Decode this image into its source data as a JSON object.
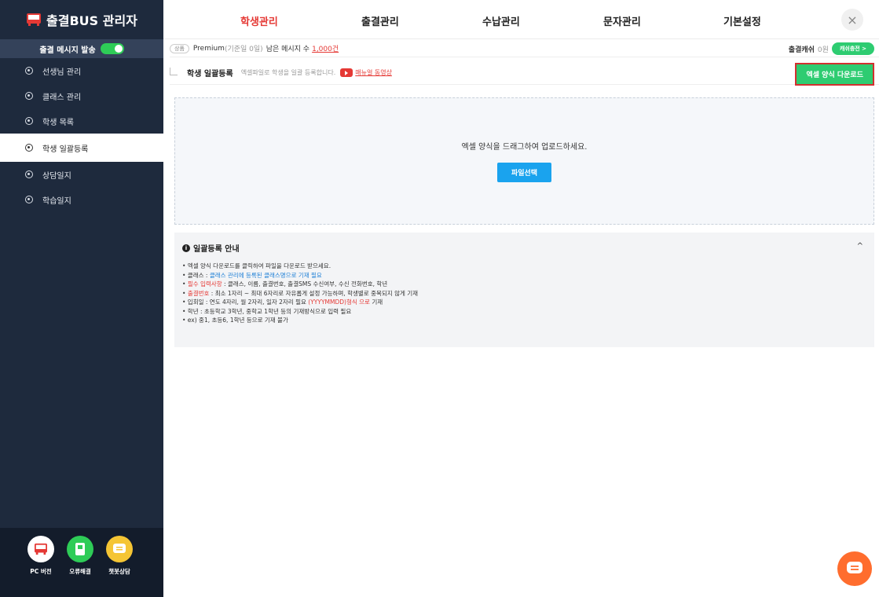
{
  "sidebar": {
    "brand": "출결BUS 관리자",
    "notify_label": "출결 메시지 발송",
    "items": [
      {
        "label": "선생님 관리"
      },
      {
        "label": "클래스 관리"
      },
      {
        "label": "학생 목록"
      },
      {
        "label": "학생 일괄등록"
      },
      {
        "label": "상담일지"
      },
      {
        "label": "학습일지"
      }
    ],
    "bottom": [
      {
        "label": "PC 버전",
        "color": "#e53935"
      },
      {
        "label": "오류해결",
        "color": "#2ecc57"
      },
      {
        "label": "챗봇상담",
        "color": "#f5c534"
      }
    ]
  },
  "topnav": {
    "tabs": [
      {
        "label": "학생관리"
      },
      {
        "label": "출결관리"
      },
      {
        "label": "수납관리"
      },
      {
        "label": "문자관리"
      },
      {
        "label": "기본설정"
      }
    ],
    "close": "×"
  },
  "infobar": {
    "tag": "상품",
    "plan": "Premium",
    "plan_note": "(기준일 0일)",
    "remain_label": "남은 메시지 수",
    "remain_value": "1,000건",
    "cash_label": "출결캐쉬",
    "cash_value": "0원",
    "cash_btn": "캐쉬충전 >"
  },
  "pagehead": {
    "title": "학생 일괄등록",
    "desc": "엑셀파일로 학생을 일괄 등록합니다.",
    "video_link": "매뉴얼 동영상",
    "download_btn": "엑셀 양식 다운로드"
  },
  "dropzone": {
    "text": "엑셀 양식을 드래그하여 업로드하세요.",
    "button": "파일선택"
  },
  "guide": {
    "title": "일괄등록 안내",
    "lines": [
      {
        "a": "• 엑셀 양식 다운로드를 클릭하여 파일을 다운로드 받으세요.",
        "b": "",
        "c": ""
      },
      {
        "a": "• 클래스 : ",
        "b": "클래스 관리에 등록된 클래스명으로 기재 필요",
        "c": ""
      },
      {
        "a": "• ",
        "b": "필수 입력사항",
        "c": " : 클래스, 이름, 출결번호, 출결SMS 수신여부, 수신 전화번호, 학년"
      },
      {
        "a": "• ",
        "b": "출결번호",
        "c": " : 최소 1자리 ~ 최대 6자리로 자유롭게 설정 가능하며, 학생별로 중복되지 않게 기재"
      },
      {
        "a": "• 입회일 : 연도 4자리, 월 2자리, 일자 2자리 필요 ",
        "b": "(YYYYMMDD)형식 으로",
        "c": " 기재"
      },
      {
        "a": "• 학년 : 초등학교 3학년, 중학교 1학년 등의 기재방식으로 입력 필요",
        "b": "",
        "c": ""
      },
      {
        "a": "• ex) 중1, 초등6, 1학년 등으로 기재 불가",
        "b": "",
        "c": ""
      }
    ]
  }
}
